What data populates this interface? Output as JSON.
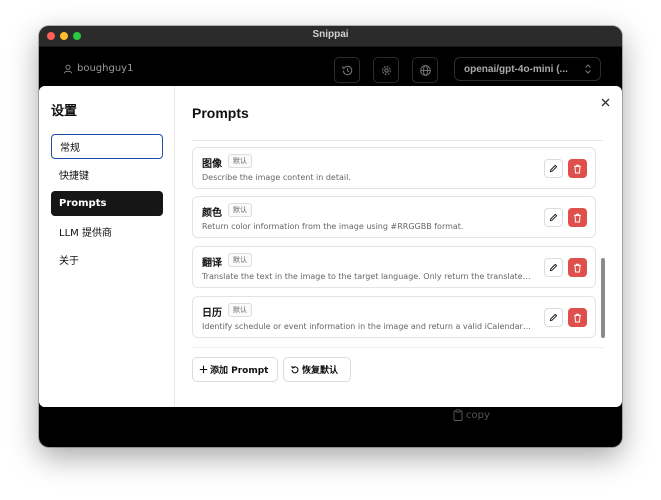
{
  "window": {
    "title": "Snippai"
  },
  "toolbar": {
    "username": "boughguy1",
    "model": "openai/gpt-4o-mini (..."
  },
  "footer": {
    "copy_label": "copy"
  },
  "sidebar": {
    "title": "设置",
    "items": [
      {
        "label": "常规"
      },
      {
        "label": "快捷键"
      },
      {
        "label": "Prompts"
      },
      {
        "label": "LLM 提供商"
      },
      {
        "label": "关于"
      }
    ]
  },
  "main": {
    "title": "Prompts",
    "prompts": [
      {
        "name": "图像",
        "badge": "默认",
        "description": "Describe the image content in detail."
      },
      {
        "name": "颜色",
        "badge": "默认",
        "description": "Return color information from the image using #RRGGBB format."
      },
      {
        "name": "翻译",
        "badge": "默认",
        "description": "Translate the text in the image to the target language. Only return the translated text."
      },
      {
        "name": "日历",
        "badge": "默认",
        "description": "Identify schedule or event information in the image and return a valid iCalendar (.ics) file."
      }
    ],
    "add_button": "添加 Prompt",
    "reset_button": "恢复默认"
  },
  "colors": {
    "accent_dark": "#161616",
    "danger": "#df4f4b",
    "focus_ring": "#1e4fae"
  }
}
